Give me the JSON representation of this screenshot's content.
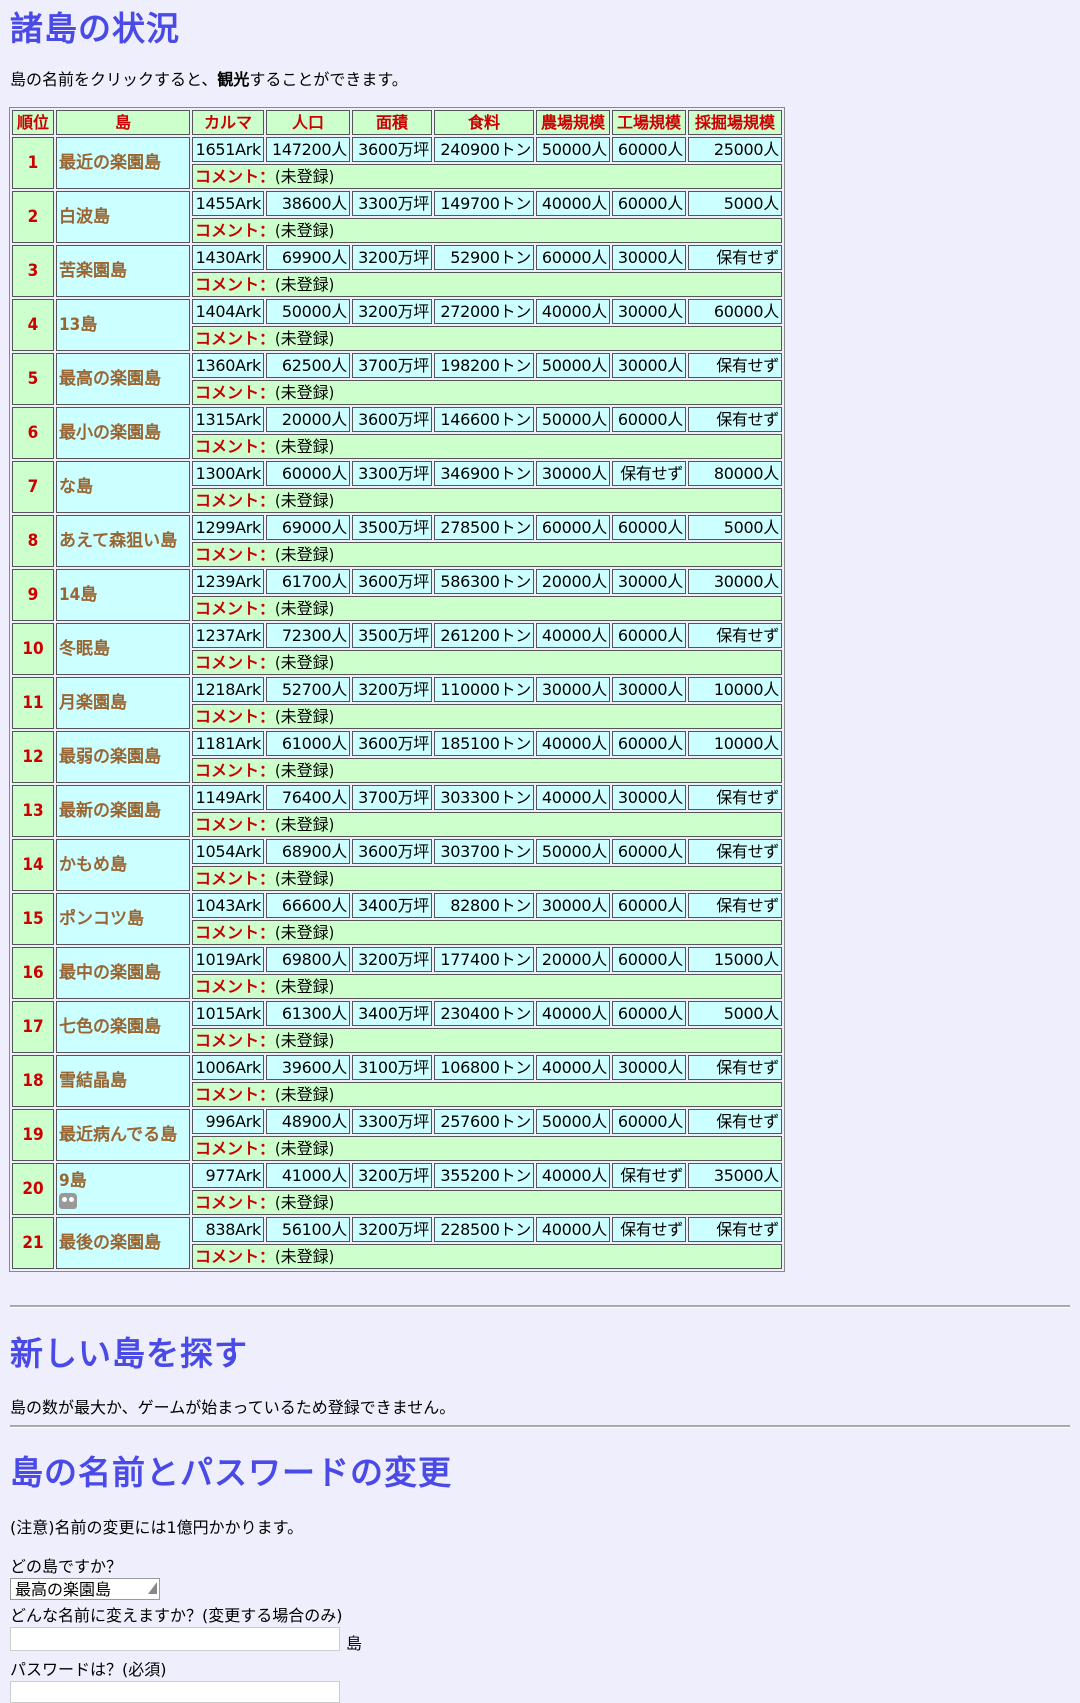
{
  "sections": {
    "status_title": "諸島の状況",
    "intro_prefix": "島の名前をクリックすると、",
    "intro_bold": "観光",
    "intro_suffix": "することができます。",
    "new_title": "新しい島を探す",
    "new_message": "島の数が最大か、ゲームが始まっているため登録できません。",
    "change_title": "島の名前とパスワードの変更",
    "change_note": "(注意)名前の変更には1億円かかります。",
    "which_island_label": "どの島ですか？",
    "selected_island": "最高の楽園島",
    "new_name_label": "どんな名前に変えますか？(変更する場合のみ)",
    "name_suffix": "島",
    "password_label": "パスワードは？(必須)"
  },
  "table": {
    "headers": [
      "順位",
      "島",
      "カルマ",
      "人口",
      "面積",
      "食料",
      "農場規模",
      "工場規模",
      "採掘場規模"
    ],
    "comment_label": "コメント：",
    "rows": [
      {
        "rank": "1",
        "name": "最近の楽園島",
        "karma": "1651Ark",
        "pop": "147200人",
        "area": "3600万坪",
        "food": "240900トン",
        "farm": "50000人",
        "factory": "60000人",
        "mine": "25000人",
        "comment": "(未登録)"
      },
      {
        "rank": "2",
        "name": "白波島",
        "karma": "1455Ark",
        "pop": "38600人",
        "area": "3300万坪",
        "food": "149700トン",
        "farm": "40000人",
        "factory": "60000人",
        "mine": "5000人",
        "comment": "(未登録)"
      },
      {
        "rank": "3",
        "name": "苦楽園島",
        "karma": "1430Ark",
        "pop": "69900人",
        "area": "3200万坪",
        "food": "52900トン",
        "farm": "60000人",
        "factory": "30000人",
        "mine": "保有せず",
        "comment": "(未登録)"
      },
      {
        "rank": "4",
        "name": "13島",
        "karma": "1404Ark",
        "pop": "50000人",
        "area": "3200万坪",
        "food": "272000トン",
        "farm": "40000人",
        "factory": "30000人",
        "mine": "60000人",
        "comment": "(未登録)"
      },
      {
        "rank": "5",
        "name": "最高の楽園島",
        "karma": "1360Ark",
        "pop": "62500人",
        "area": "3700万坪",
        "food": "198200トン",
        "farm": "50000人",
        "factory": "30000人",
        "mine": "保有せず",
        "comment": "(未登録)"
      },
      {
        "rank": "6",
        "name": "最小の楽園島",
        "karma": "1315Ark",
        "pop": "20000人",
        "area": "3600万坪",
        "food": "146600トン",
        "farm": "50000人",
        "factory": "60000人",
        "mine": "保有せず",
        "comment": "(未登録)"
      },
      {
        "rank": "7",
        "name": "な島",
        "karma": "1300Ark",
        "pop": "60000人",
        "area": "3300万坪",
        "food": "346900トン",
        "farm": "30000人",
        "factory": "保有せず",
        "mine": "80000人",
        "comment": "(未登録)"
      },
      {
        "rank": "8",
        "name": "あえて森狙い島",
        "karma": "1299Ark",
        "pop": "69000人",
        "area": "3500万坪",
        "food": "278500トン",
        "farm": "60000人",
        "factory": "60000人",
        "mine": "5000人",
        "comment": "(未登録)"
      },
      {
        "rank": "9",
        "name": "14島",
        "karma": "1239Ark",
        "pop": "61700人",
        "area": "3600万坪",
        "food": "586300トン",
        "farm": "20000人",
        "factory": "30000人",
        "mine": "30000人",
        "comment": "(未登録)"
      },
      {
        "rank": "10",
        "name": "冬眠島",
        "karma": "1237Ark",
        "pop": "72300人",
        "area": "3500万坪",
        "food": "261200トン",
        "farm": "40000人",
        "factory": "60000人",
        "mine": "保有せず",
        "comment": "(未登録)"
      },
      {
        "rank": "11",
        "name": "月楽園島",
        "karma": "1218Ark",
        "pop": "52700人",
        "area": "3200万坪",
        "food": "110000トン",
        "farm": "30000人",
        "factory": "30000人",
        "mine": "10000人",
        "comment": "(未登録)"
      },
      {
        "rank": "12",
        "name": "最弱の楽園島",
        "karma": "1181Ark",
        "pop": "61000人",
        "area": "3600万坪",
        "food": "185100トン",
        "farm": "40000人",
        "factory": "60000人",
        "mine": "10000人",
        "comment": "(未登録)"
      },
      {
        "rank": "13",
        "name": "最新の楽園島",
        "karma": "1149Ark",
        "pop": "76400人",
        "area": "3700万坪",
        "food": "303300トン",
        "farm": "40000人",
        "factory": "30000人",
        "mine": "保有せず",
        "comment": "(未登録)"
      },
      {
        "rank": "14",
        "name": "かもめ島",
        "karma": "1054Ark",
        "pop": "68900人",
        "area": "3600万坪",
        "food": "303700トン",
        "farm": "50000人",
        "factory": "60000人",
        "mine": "保有せず",
        "comment": "(未登録)"
      },
      {
        "rank": "15",
        "name": "ポンコツ島",
        "karma": "1043Ark",
        "pop": "66600人",
        "area": "3400万坪",
        "food": "82800トン",
        "farm": "30000人",
        "factory": "60000人",
        "mine": "保有せず",
        "comment": "(未登録)"
      },
      {
        "rank": "16",
        "name": "最中の楽園島",
        "karma": "1019Ark",
        "pop": "69800人",
        "area": "3200万坪",
        "food": "177400トン",
        "farm": "20000人",
        "factory": "60000人",
        "mine": "15000人",
        "comment": "(未登録)"
      },
      {
        "rank": "17",
        "name": "七色の楽園島",
        "karma": "1015Ark",
        "pop": "61300人",
        "area": "3400万坪",
        "food": "230400トン",
        "farm": "40000人",
        "factory": "60000人",
        "mine": "5000人",
        "comment": "(未登録)"
      },
      {
        "rank": "18",
        "name": "雪結晶島",
        "karma": "1006Ark",
        "pop": "39600人",
        "area": "3100万坪",
        "food": "106800トン",
        "farm": "40000人",
        "factory": "30000人",
        "mine": "保有せず",
        "comment": "(未登録)"
      },
      {
        "rank": "19",
        "name": "最近病んでる島",
        "karma": "996Ark",
        "pop": "48900人",
        "area": "3300万坪",
        "food": "257600トン",
        "farm": "50000人",
        "factory": "60000人",
        "mine": "保有せず",
        "comment": "(未登録)"
      },
      {
        "rank": "20",
        "name": "9島",
        "karma": "977Ark",
        "pop": "41000人",
        "area": "3200万坪",
        "food": "355200トン",
        "farm": "40000人",
        "factory": "保有せず",
        "mine": "35000人",
        "comment": "(未登録)",
        "icon": "robot-icon"
      },
      {
        "rank": "21",
        "name": "最後の楽園島",
        "karma": "838Ark",
        "pop": "56100人",
        "area": "3200万坪",
        "food": "228500トン",
        "farm": "40000人",
        "factory": "保有せず",
        "mine": "保有せず",
        "comment": "(未登録)"
      }
    ]
  }
}
